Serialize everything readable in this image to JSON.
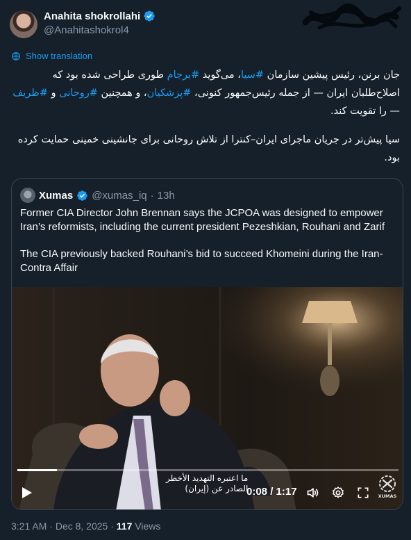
{
  "author": {
    "display_name": "Anahita shokrollahi",
    "handle": "@Anahitashokrol4"
  },
  "show_translation": "Show translation",
  "tweet": {
    "p1": [
      {
        "text": "جان برنن، رئیس پیشین سازمان ",
        "tag": false
      },
      {
        "text": "#سیا",
        "tag": true
      },
      {
        "text": "، می‌گوید ",
        "tag": false
      },
      {
        "text": "#برجام",
        "tag": true
      },
      {
        "text": " طوری طراحی شده بود که اصلاح‌طلبان ایران — از جمله رئیس‌جمهور کنونی، ",
        "tag": false
      },
      {
        "text": "#پزشکیان",
        "tag": true
      },
      {
        "text": "، و همچنین ",
        "tag": false
      },
      {
        "text": "#روحانی",
        "tag": true
      },
      {
        "text": " و ",
        "tag": false
      },
      {
        "text": "#ظریف",
        "tag": true
      },
      {
        "text": " — را تقویت کند.",
        "tag": false
      }
    ],
    "p2": "سیا پیش‌تر در جریان ماجرای ایران–کنترا از تلاش روحانی برای جانشینی خمینی حمایت کرده بود."
  },
  "quote": {
    "name": "Xumas",
    "handle": "@xumas_iq",
    "sep": "·",
    "age": "13h",
    "p1": "Former CIA Director John Brennan says the JCPOA was designed to empower Iran’s reformists, including the current president Pezeshkian, Rouhani and Zarif",
    "p2": "The CIA previously backed Rouhani’s bid to succeed Khomeini during the Iran-Contra Affair"
  },
  "video": {
    "time": "0:08 / 1:17",
    "progress": 0.104,
    "subtitle_line1": "ما اعتبره التهديد الأخطر",
    "subtitle_line2": "الصادر عن (إيران)",
    "logo_text": "XUMAS"
  },
  "footer": {
    "time": "3:21 AM",
    "dot": " · ",
    "date": "Dec 8, 2025",
    "dot2": " · ",
    "views_count": "117",
    "views_label": " Views"
  },
  "colors": {
    "background": "#15202b",
    "link": "#1d9bf0",
    "muted": "#8b98a5",
    "border": "#38444d"
  }
}
